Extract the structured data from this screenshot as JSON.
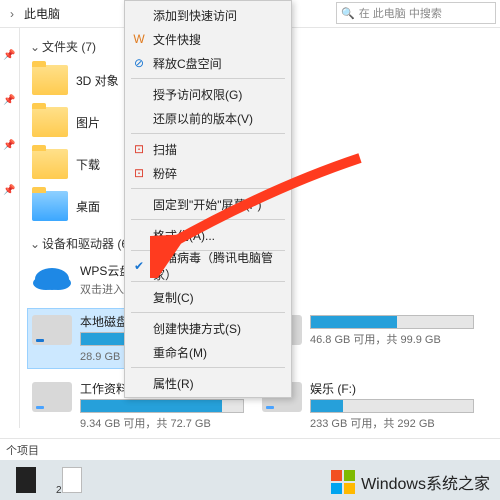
{
  "header": {
    "breadcrumb_sep": "›",
    "title": "此电脑"
  },
  "search": {
    "placeholder": "在 此电脑 中搜索"
  },
  "sections": {
    "folders": {
      "label": "文件夹 (7)"
    },
    "drives": {
      "label": "设备和驱动器 (6)"
    }
  },
  "folders": [
    {
      "label": "3D 对象"
    },
    {
      "label": "图片"
    },
    {
      "label": "下载"
    },
    {
      "label": "桌面"
    }
  ],
  "wpscloud": {
    "title": "WPS云盘",
    "sub": "双击进入WP"
  },
  "drives": [
    {
      "title": "本地磁盘 (C:",
      "sub": "28.9 GB 可用，共 105 GB",
      "fill": 72,
      "selected": true
    },
    {
      "title": "",
      "sub": "46.8 GB 可用，共 99.9 GB",
      "fill": 53,
      "selected": false
    },
    {
      "title": "工作资料 (E:)",
      "sub": "9.34 GB 可用，共 72.7 GB",
      "fill": 87,
      "selected": false
    },
    {
      "title": "娱乐 (F:)",
      "sub": "233 GB 可用，共 292 GB",
      "fill": 20,
      "selected": false
    }
  ],
  "context_menu": [
    {
      "label": "添加到快速访问",
      "icon": ""
    },
    {
      "label": "文件快搜",
      "icon": "W",
      "iconClass": "orange"
    },
    {
      "label": "释放C盘空间",
      "icon": "⊘",
      "iconClass": "blue",
      "sepAfter": true
    },
    {
      "label": "授予访问权限(G)",
      "icon": ""
    },
    {
      "label": "还原以前的版本(V)",
      "icon": "",
      "sepAfter": true
    },
    {
      "label": "扫描",
      "icon": "⊡",
      "iconClass": "red"
    },
    {
      "label": "粉碎",
      "icon": "⊡",
      "iconClass": "red",
      "sepAfter": true
    },
    {
      "label": "固定到\"开始\"屏幕(P)",
      "icon": "",
      "sepAfter": true
    },
    {
      "label": "格式化(A)...",
      "icon": "",
      "sepAfter": true
    },
    {
      "label": "扫描病毒（腾讯电脑管家）",
      "icon": "✔",
      "iconClass": "blue",
      "sepAfter": true
    },
    {
      "label": "复制(C)",
      "icon": "",
      "sepAfter": true
    },
    {
      "label": "创建快捷方式(S)",
      "icon": ""
    },
    {
      "label": "重命名(M)",
      "icon": "",
      "sepAfter": true
    },
    {
      "label": "属性(R)",
      "icon": ""
    }
  ],
  "status": {
    "text": "个项目"
  },
  "taskbar": {
    "count": "2"
  },
  "watermark": {
    "text": "Windows系统之家"
  }
}
